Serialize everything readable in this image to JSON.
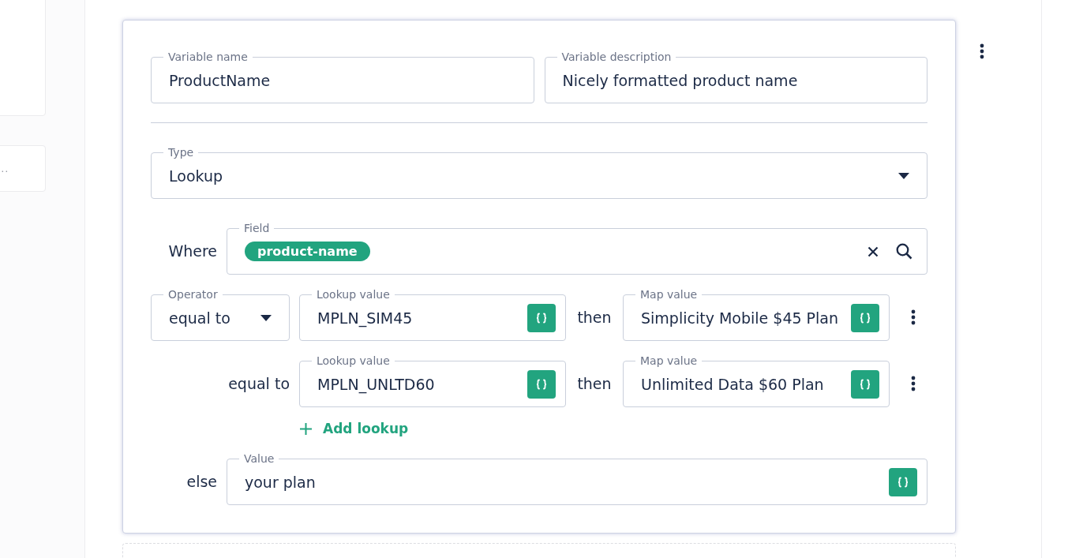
{
  "left_panel": {
    "truncated_text": "..."
  },
  "variable": {
    "name": {
      "label": "Variable name",
      "value": "ProductName"
    },
    "description": {
      "label": "Variable description",
      "value": "Nicely formatted product name"
    }
  },
  "type": {
    "label": "Type",
    "value": "Lookup"
  },
  "where": {
    "label": "Where",
    "field_label": "Field",
    "chip": "product-name"
  },
  "lookups": [
    {
      "kind": "dropdown",
      "operator_label": "Operator",
      "operator": "equal to",
      "lookup_label": "Lookup value",
      "lookup_value": "MPLN_SIM45",
      "then": "then",
      "map_label": "Map value",
      "map_value": "Simplicity Mobile $45 Plan"
    },
    {
      "kind": "plain",
      "operator": "equal to",
      "lookup_label": "Lookup value",
      "lookup_value": "MPLN_UNLTD60",
      "then": "then",
      "map_label": "Map value",
      "map_value": "Unlimited Data $60 Plan"
    }
  ],
  "add_lookup": "Add lookup",
  "else": {
    "label": "else",
    "field_label": "Value",
    "value": "your plan"
  }
}
